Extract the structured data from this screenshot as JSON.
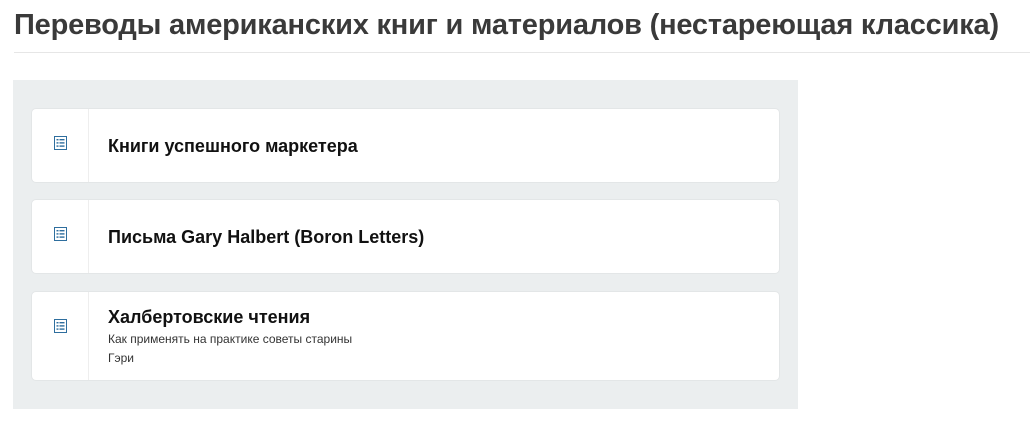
{
  "page": {
    "title": "Переводы американских книг и материалов (нестареющая классика)"
  },
  "colors": {
    "panel_bg": "#ebeeef",
    "icon_accent": "#2e6e9e"
  },
  "items": [
    {
      "icon": "document-list-icon",
      "title": "Книги успешного маркетера",
      "description": ""
    },
    {
      "icon": "document-list-icon",
      "title": "Письма Gary Halbert (Boron Letters)",
      "description": ""
    },
    {
      "icon": "document-list-icon",
      "title": "Халбертовские чтения",
      "description": "Как применять на практике советы старины Гэри"
    }
  ]
}
